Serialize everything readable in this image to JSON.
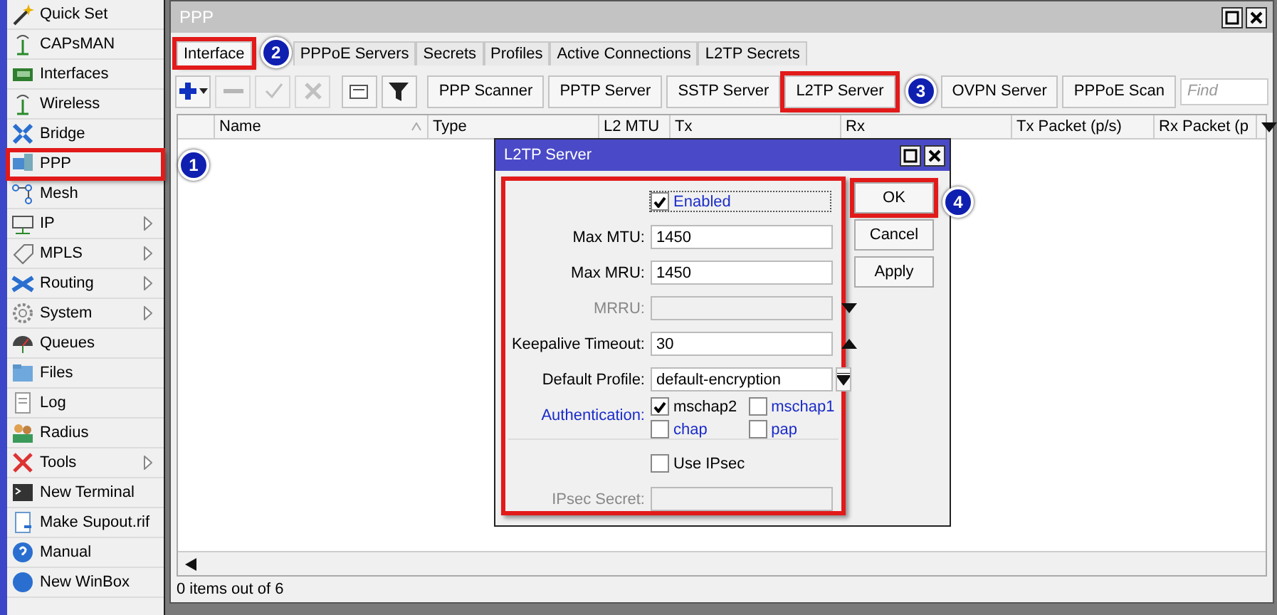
{
  "sidebar": {
    "items": [
      {
        "label": "Quick Set",
        "has_submenu": false,
        "highlighted": false
      },
      {
        "label": "CAPsMAN",
        "has_submenu": false,
        "highlighted": false
      },
      {
        "label": "Interfaces",
        "has_submenu": false,
        "highlighted": false
      },
      {
        "label": "Wireless",
        "has_submenu": false,
        "highlighted": false
      },
      {
        "label": "Bridge",
        "has_submenu": false,
        "highlighted": false
      },
      {
        "label": "PPP",
        "has_submenu": false,
        "highlighted": true,
        "callout": "1"
      },
      {
        "label": "Mesh",
        "has_submenu": false,
        "highlighted": false
      },
      {
        "label": "IP",
        "has_submenu": true,
        "highlighted": false
      },
      {
        "label": "MPLS",
        "has_submenu": true,
        "highlighted": false
      },
      {
        "label": "Routing",
        "has_submenu": true,
        "highlighted": false
      },
      {
        "label": "System",
        "has_submenu": true,
        "highlighted": false
      },
      {
        "label": "Queues",
        "has_submenu": false,
        "highlighted": false
      },
      {
        "label": "Files",
        "has_submenu": false,
        "highlighted": false
      },
      {
        "label": "Log",
        "has_submenu": false,
        "highlighted": false
      },
      {
        "label": "Radius",
        "has_submenu": false,
        "highlighted": false
      },
      {
        "label": "Tools",
        "has_submenu": true,
        "highlighted": false
      },
      {
        "label": "New Terminal",
        "has_submenu": false,
        "highlighted": false
      },
      {
        "label": "Make Supout.rif",
        "has_submenu": false,
        "highlighted": false
      },
      {
        "label": "Manual",
        "has_submenu": false,
        "highlighted": false
      },
      {
        "label": "New WinBox",
        "has_submenu": false,
        "highlighted": false
      }
    ]
  },
  "window": {
    "title": "PPP",
    "tabs": [
      {
        "label": "Interface",
        "selected": true,
        "highlighted": true,
        "callout": "2"
      },
      {
        "label": "PPPoE Servers",
        "selected": false,
        "highlighted": false
      },
      {
        "label": "Secrets",
        "selected": false,
        "highlighted": false
      },
      {
        "label": "Profiles",
        "selected": false,
        "highlighted": false
      },
      {
        "label": "Active Connections",
        "selected": false,
        "highlighted": false
      },
      {
        "label": "L2TP Secrets",
        "selected": false,
        "highlighted": false
      }
    ],
    "icon_tools": [
      {
        "disabled": false
      },
      {
        "disabled": true
      },
      {
        "disabled": true
      },
      {
        "disabled": true
      },
      {
        "disabled": false
      },
      {
        "disabled": false
      }
    ],
    "toolbar_buttons": [
      {
        "label": "PPP Scanner",
        "highlighted": false
      },
      {
        "label": "PPTP Server",
        "highlighted": false
      },
      {
        "label": "SSTP Server",
        "highlighted": false
      },
      {
        "label": "L2TP Server",
        "highlighted": true,
        "callout": "3"
      },
      {
        "label": "OVPN Server",
        "highlighted": false
      },
      {
        "label": "PPPoE Scan",
        "highlighted": false
      }
    ],
    "search": {
      "placeholder": "Find"
    },
    "table": {
      "columns": [
        "Name",
        "Type",
        "L2 MTU",
        "Tx",
        "Rx",
        "Tx Packet (p/s)",
        "Rx Packet (p"
      ]
    },
    "status_bar": "0 items out of 6"
  },
  "dialog": {
    "title": "L2TP Server",
    "form_highlighted": true,
    "fields": [
      {
        "kind": "checkbox",
        "label": "Enabled",
        "checked": true
      },
      {
        "kind": "text",
        "label": "Max MTU:",
        "value": "1450",
        "disabled": false
      },
      {
        "kind": "text",
        "label": "Max MRU:",
        "value": "1450",
        "disabled": false
      },
      {
        "kind": "expandable",
        "label": "MRRU:",
        "disabled": true,
        "expanded": false
      },
      {
        "kind": "expandable",
        "label": "Keepalive Timeout:",
        "value": "30",
        "disabled": false,
        "expanded": true
      },
      {
        "kind": "select",
        "label": "Default Profile:",
        "value": "default-encryption"
      },
      {
        "kind": "checks",
        "label": "Authentication:",
        "options": [
          {
            "label": "mschap2",
            "checked": true
          },
          {
            "label": "mschap1",
            "checked": false
          },
          {
            "label": "chap",
            "checked": false
          },
          {
            "label": "pap",
            "checked": false
          }
        ]
      },
      {
        "kind": "separator"
      },
      {
        "kind": "checkbox",
        "label": "Use IPsec",
        "checked": false
      },
      {
        "kind": "text",
        "label": "IPsec Secret:",
        "disabled": true
      }
    ],
    "buttons": [
      {
        "label": "OK",
        "highlighted": true,
        "callout": "4"
      },
      {
        "label": "Cancel",
        "highlighted": false
      },
      {
        "label": "Apply",
        "highlighted": false
      }
    ]
  }
}
